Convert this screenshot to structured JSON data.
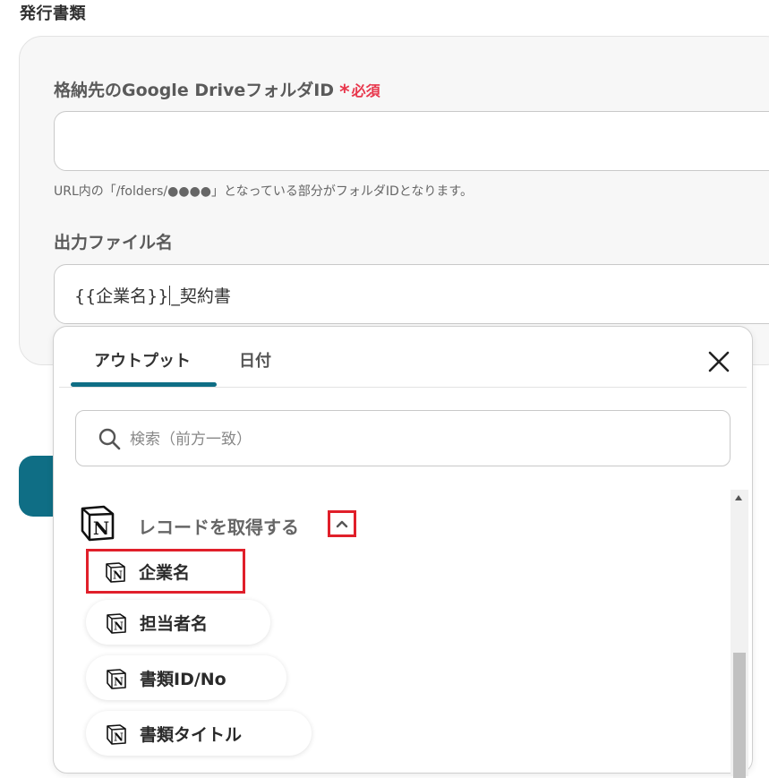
{
  "section": {
    "title": "発行書類"
  },
  "form": {
    "folder_label": "格納先のGoogle DriveフォルダID",
    "required_star": "*",
    "required_text": "必須",
    "folder_value": "",
    "folder_helper": "URL内の「/folders/●●●●」となっている部分がフォルダIDとなります。",
    "filename_label": "出力ファイル名",
    "filename_part1": "{{企業名}}",
    "filename_part2": "_契約書"
  },
  "popup": {
    "tabs": [
      {
        "label": "アウトプット",
        "active": true
      },
      {
        "label": "日付",
        "active": false
      }
    ],
    "search_placeholder": "検索（前方一致）",
    "group": {
      "title": "レコードを取得する",
      "icon": "notion-icon",
      "expanded": true
    },
    "items": [
      {
        "label": "企業名",
        "icon": "notion-icon",
        "highlighted": true
      },
      {
        "label": "担当者名",
        "icon": "notion-icon",
        "highlighted": false
      },
      {
        "label": "書類ID/No",
        "icon": "notion-icon",
        "highlighted": false
      },
      {
        "label": "書類タイトル",
        "icon": "notion-icon",
        "highlighted": false
      }
    ]
  },
  "colors": {
    "accent": "#0f6e85",
    "required": "#e8374c",
    "highlight_border": "#e01f2a"
  }
}
